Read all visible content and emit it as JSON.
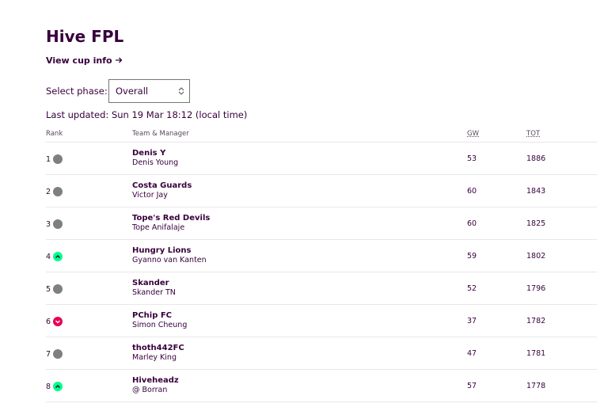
{
  "page": {
    "title": "Hive FPL",
    "cup_link": "View cup info",
    "phase_label": "Select phase:",
    "phase_value": "Overall",
    "last_updated": "Last updated: Sun 19 Mar 18:12 (local time)"
  },
  "table": {
    "headers": {
      "rank": "Rank",
      "team": "Team & Manager",
      "gw": "GW",
      "tot": "TOT"
    },
    "rows": [
      {
        "rank": "1",
        "movement": "same",
        "team": "Denis Y",
        "manager": "Denis Young",
        "gw": "53",
        "tot": "1886"
      },
      {
        "rank": "2",
        "movement": "same",
        "team": "Costa Guards",
        "manager": "Victor Jay",
        "gw": "60",
        "tot": "1843"
      },
      {
        "rank": "3",
        "movement": "same",
        "team": "Tope's Red Devils",
        "manager": "Tope Anifalaje",
        "gw": "60",
        "tot": "1825"
      },
      {
        "rank": "4",
        "movement": "up",
        "team": "Hungry Lions",
        "manager": "Gyanno van Kanten",
        "gw": "59",
        "tot": "1802"
      },
      {
        "rank": "5",
        "movement": "same",
        "team": "Skander",
        "manager": "Skander TN",
        "gw": "52",
        "tot": "1796"
      },
      {
        "rank": "6",
        "movement": "down",
        "team": "PChip FC",
        "manager": "Simon Cheung",
        "gw": "37",
        "tot": "1782"
      },
      {
        "rank": "7",
        "movement": "same",
        "team": "thoth442FC",
        "manager": "Marley King",
        "gw": "47",
        "tot": "1781"
      },
      {
        "rank": "8",
        "movement": "up",
        "team": "Hiveheadz",
        "manager": "@ Borran",
        "gw": "57",
        "tot": "1778"
      }
    ]
  },
  "colors": {
    "primary": "#37003c",
    "up": "#00ff87",
    "down": "#e90052",
    "same": "#7f7f7f"
  }
}
